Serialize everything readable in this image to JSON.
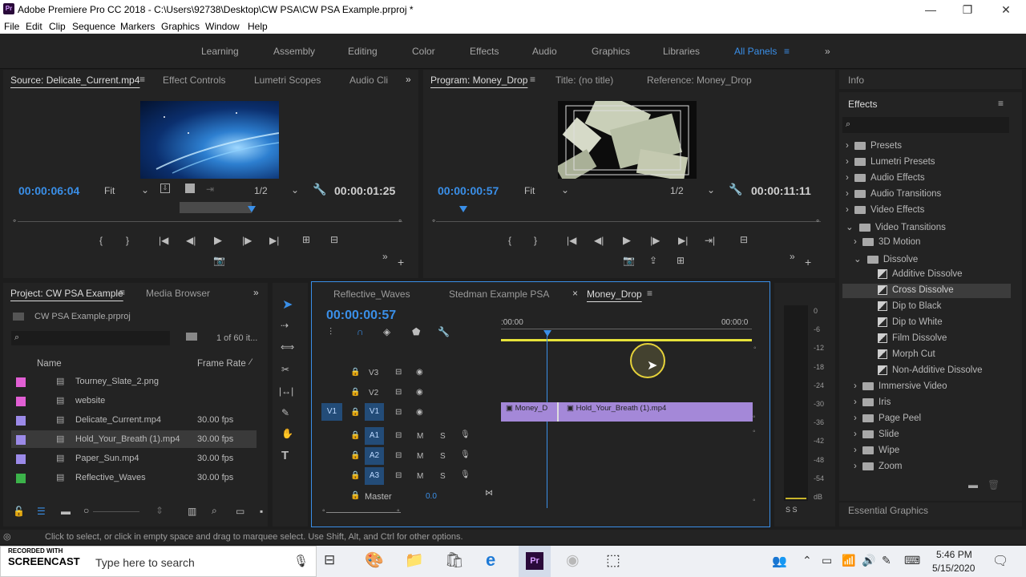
{
  "window": {
    "title": "Adobe Premiere Pro CC 2018 - C:\\Users\\92738\\Desktop\\CW PSA\\CW PSA Example.prproj *",
    "app_icon": "Pr",
    "minimize": "—",
    "restore": "❐",
    "close": "✕"
  },
  "menu": [
    "File",
    "Edit",
    "Clip",
    "Sequence",
    "Markers",
    "Graphics",
    "Window",
    "Help"
  ],
  "workspaces": [
    "Learning",
    "Assembly",
    "Editing",
    "Color",
    "Effects",
    "Audio",
    "Graphics",
    "Libraries",
    "All Panels"
  ],
  "workspace_active": "All Panels",
  "source_panel": {
    "tabs": [
      "Source: Delicate_Current.mp4",
      "Effect Controls",
      "Lumetri Scopes",
      "Audio Cli"
    ],
    "timecode": "00:00:06:04",
    "fit": "Fit",
    "resolution": "1/2",
    "duration": "00:00:01:25"
  },
  "program_panel": {
    "tabs": [
      "Program: Money_Drop",
      "Title: (no title)",
      "Reference: Money_Drop"
    ],
    "timecode": "00:00:00:57",
    "fit": "Fit",
    "resolution": "1/2",
    "duration": "00:00:11:11"
  },
  "info_panel": {
    "title": "Info"
  },
  "effects_panel": {
    "title": "Effects",
    "items": [
      {
        "label": "Presets",
        "kind": "folder",
        "level": 0
      },
      {
        "label": "Lumetri Presets",
        "kind": "folder",
        "level": 0
      },
      {
        "label": "Audio Effects",
        "kind": "folder",
        "level": 0
      },
      {
        "label": "Audio Transitions",
        "kind": "folder",
        "level": 0
      },
      {
        "label": "Video Effects",
        "kind": "folder",
        "level": 0
      },
      {
        "label": "Video Transitions",
        "kind": "folder",
        "level": 0
      },
      {
        "label": "3D Motion",
        "kind": "folder",
        "level": 1
      },
      {
        "label": "Dissolve",
        "kind": "folder",
        "level": 1
      },
      {
        "label": "Additive Dissolve",
        "kind": "fx",
        "level": 2
      },
      {
        "label": "Cross Dissolve",
        "kind": "fx",
        "level": 2
      },
      {
        "label": "Dip to Black",
        "kind": "fx",
        "level": 2
      },
      {
        "label": "Dip to White",
        "kind": "fx",
        "level": 2
      },
      {
        "label": "Film Dissolve",
        "kind": "fx",
        "level": 2
      },
      {
        "label": "Morph Cut",
        "kind": "fx",
        "level": 2
      },
      {
        "label": "Non-Additive Dissolve",
        "kind": "fx",
        "level": 2
      },
      {
        "label": "Immersive Video",
        "kind": "folder",
        "level": 1
      },
      {
        "label": "Iris",
        "kind": "folder",
        "level": 1
      },
      {
        "label": "Page Peel",
        "kind": "folder",
        "level": 1
      },
      {
        "label": "Slide",
        "kind": "folder",
        "level": 1
      },
      {
        "label": "Wipe",
        "kind": "folder",
        "level": 1
      },
      {
        "label": "Zoom",
        "kind": "folder",
        "level": 1
      }
    ],
    "selected": "Cross Dissolve",
    "essential_graphics": "Essential Graphics"
  },
  "project_panel": {
    "tabs": [
      "Project: CW PSA Example",
      "Media Browser"
    ],
    "file": "CW PSA Example.prproj",
    "count": "1 of 60 it...",
    "col_name": "Name",
    "col_rate": "Frame Rate",
    "rows": [
      {
        "name": "Tourney_Slate_2.png",
        "rate": "",
        "color": "#e15fd4"
      },
      {
        "name": "website",
        "rate": "",
        "color": "#e15fd4"
      },
      {
        "name": "Delicate_Current.mp4",
        "rate": "30.00 fps",
        "color": "#9b8ae8"
      },
      {
        "name": "Hold_Your_Breath (1).mp4",
        "rate": "30.00 fps",
        "color": "#9b8ae8"
      },
      {
        "name": "Paper_Sun.mp4",
        "rate": "30.00 fps",
        "color": "#9b8ae8"
      },
      {
        "name": "Reflective_Waves",
        "rate": "30.00 fps",
        "color": "#3cb34a"
      }
    ]
  },
  "timeline": {
    "tabs": [
      "Reflective_Waves",
      "Stedman Example PSA",
      "Money_Drop"
    ],
    "close_x": "×",
    "timecode": "00:00:00:57",
    "ruler_start": ":00:00",
    "ruler_end": "00:00:0",
    "tracks_video": [
      "V3",
      "V2",
      "V1"
    ],
    "source_patch": "V1",
    "tracks_audio": [
      "A1",
      "A2",
      "A3"
    ],
    "master_label": "Master",
    "master_value": "0.0",
    "clip1": "Money_D",
    "clip2": "Hold_Your_Breath (1).mp4",
    "m": "M",
    "s": "S"
  },
  "meter": {
    "scale": [
      "0",
      "-6",
      "-12",
      "-18",
      "-24",
      "-30",
      "-36",
      "-42",
      "-48",
      "-54",
      "dB"
    ],
    "solo": "S S"
  },
  "status_bar": "Click to select, or click in empty space and drag to marquee select. Use Shift, Alt, and Ctrl for other options.",
  "taskbar": {
    "search": "Type here to search",
    "watermark_top": "RECORDED WITH",
    "watermark": "SCREENCAST",
    "time": "5:46 PM",
    "date": "5/15/2020"
  }
}
